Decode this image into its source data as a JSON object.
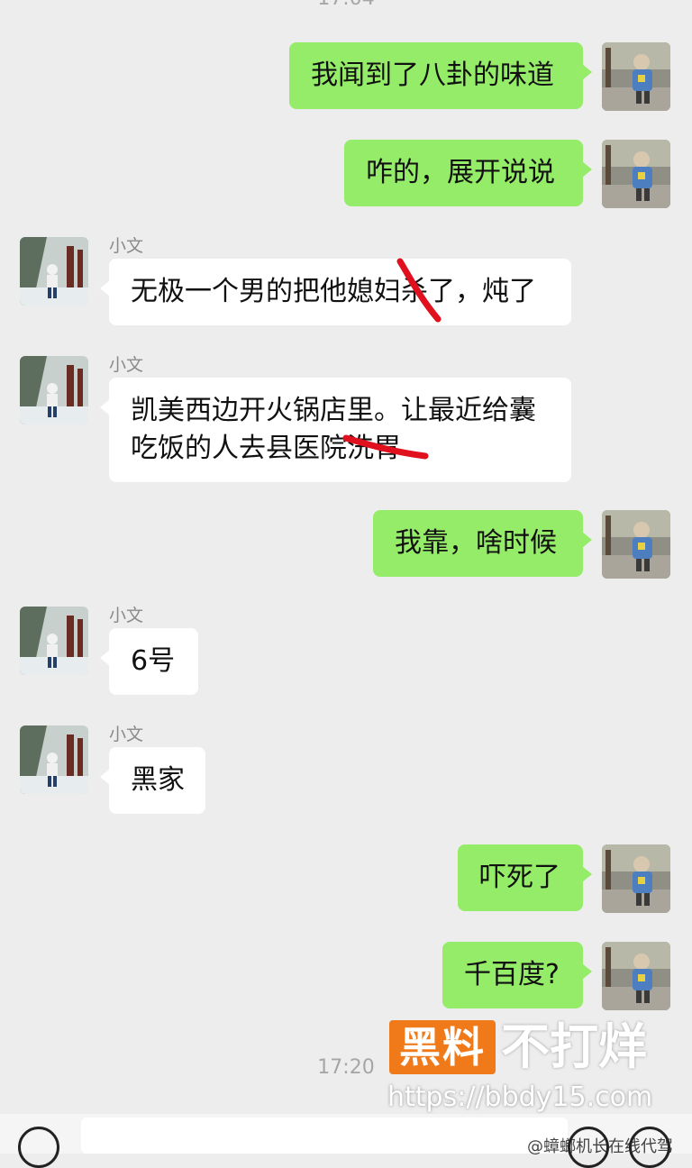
{
  "chat": {
    "top_time": "17:04",
    "bottom_time": "17:20",
    "messages": [
      {
        "side": "me",
        "text": "我闻到了八卦的味道"
      },
      {
        "side": "me",
        "text": "咋的，展开说说"
      },
      {
        "side": "other",
        "name": "小文",
        "text": "无极一个男的把他媳妇杀了，炖了"
      },
      {
        "side": "other",
        "name": "小文",
        "lines": [
          "凯美西边开火锅店里。让最近给囊",
          "吃饭的人去县医院洗胃"
        ]
      },
      {
        "side": "me",
        "text": "我靠，啥时候"
      },
      {
        "side": "other",
        "name": "小文",
        "text": "6号"
      },
      {
        "side": "other",
        "name": "小文",
        "text": "黑家"
      },
      {
        "side": "me",
        "text": "吓死了"
      },
      {
        "side": "me",
        "text": "千百度?"
      }
    ]
  },
  "watermark": {
    "badge": "黑料",
    "title": "不打烊",
    "url": "https://bbdy15.com"
  },
  "footer": {
    "credit": "@蟑螂机长在线代驾"
  },
  "colors": {
    "my_bubble": "#95ec69",
    "other_bubble": "#ffffff",
    "background": "#ededed",
    "redaction_stroke": "#e0101e"
  },
  "icons": {
    "voice": "voice-icon",
    "emoji": "emoji-icon",
    "more": "plus-icon",
    "my_avatar": "user-avatar",
    "other_avatar": "contact-avatar"
  }
}
